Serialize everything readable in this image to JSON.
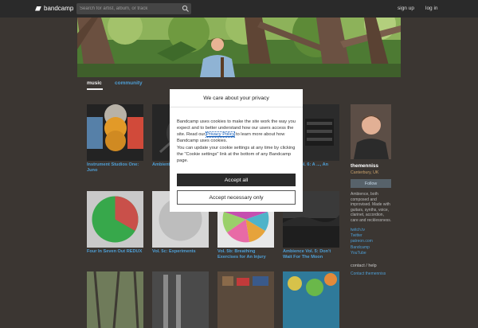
{
  "header": {
    "logo_text": "bandcamp",
    "search_placeholder": "Search for artist, album, or track",
    "signup": "sign up",
    "login": "log in"
  },
  "tabs": {
    "music": "music",
    "community": "community"
  },
  "albums": [
    {
      "title": "Instrument Studios One: Juno"
    },
    {
      "title": "Ambient... banjo"
    },
    {
      "title": ""
    },
    {
      "title": "...ence Vol. 6: A ..., An Ending"
    },
    {
      "title": "Four In Seven Out REDUX"
    },
    {
      "title": "Vol. 5c: Experiments"
    },
    {
      "title": "Vol. 5b: Breathing Exercises for An Injury"
    },
    {
      "title": "Ambience Vol. 5: Don't Wait For The Moon"
    },
    {
      "title": ""
    },
    {
      "title": ""
    },
    {
      "title": ""
    },
    {
      "title": ""
    }
  ],
  "profile": {
    "name": "themenniss",
    "location": "Canterbury, UK",
    "follow": "Follow",
    "bio": "Ambience, both composed and improvised. Made with guitars, synths, voice, clarinet, accordion, care and recklessness.",
    "links": [
      "twitch.tv",
      "Twitter",
      "patreon.com",
      "Bandcamp",
      "YouTube"
    ],
    "contact_heading": "contact / help",
    "contact_link": "Contact themenniss"
  },
  "cookie_dialog": {
    "title": "We care about your privacy",
    "p1_before": "Bandcamp uses cookies to make the site work the way you expect and to better understand how our users access the site. Read our ",
    "p1_link": "Privacy Policy",
    "p1_after": " to learn more about how Bandcamp uses cookies.",
    "p2": "You can update your cookie settings at any time by clicking the \"Cookie settings\" link at the bottom of any Bandcamp page.",
    "accept_all": "Accept all",
    "accept_necessary": "Accept necessary only"
  },
  "colors": {
    "topbar": "#2a2a2a",
    "page_bg": "#3b3632",
    "link": "#4e9fd6",
    "location": "#c9a36d"
  }
}
